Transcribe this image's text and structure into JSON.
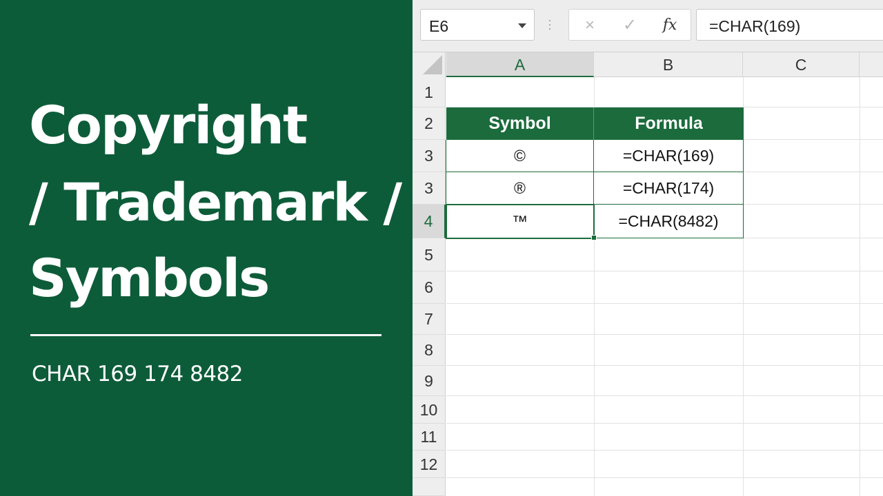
{
  "banner": {
    "title_line_1": "Copyright",
    "title_line_2": "/ Trademark /",
    "title_line_3": "Symbols",
    "subtitle": "CHAR 169 174 8482",
    "background_color": "#0d5c39"
  },
  "formula_bar": {
    "name_box": "E6",
    "cancel_icon": "×",
    "enter_icon": "✓",
    "function_icon": "fx",
    "formula": "=CHAR(169)"
  },
  "columns": [
    "A",
    "B",
    "C"
  ],
  "rows": [
    "1",
    "2",
    "3",
    "3",
    "4",
    "5",
    "6",
    "7",
    "8",
    "9",
    "10",
    "11",
    "12"
  ],
  "table": {
    "headers": [
      "Symbol",
      "Formula"
    ],
    "rows": [
      {
        "symbol": "©",
        "formula": "=CHAR(169)"
      },
      {
        "symbol": "®",
        "formula": "=CHAR(174)"
      },
      {
        "symbol": "™",
        "formula": "=CHAR(8482)"
      }
    ],
    "header_color": "#1b6b3c"
  }
}
